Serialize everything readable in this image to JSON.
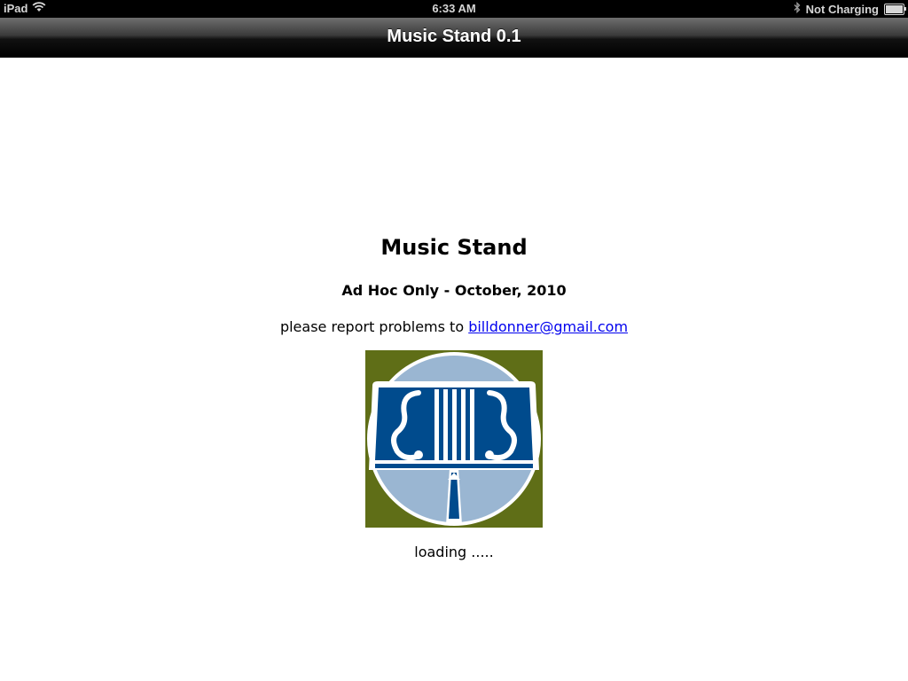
{
  "status_bar": {
    "device": "iPad",
    "time": "6:33 AM",
    "charging": "Not Charging",
    "battery_level": 1.0,
    "icons": [
      "wifi-icon",
      "bluetooth-icon",
      "battery-icon"
    ]
  },
  "nav_bar": {
    "title": "Music Stand 0.1"
  },
  "main": {
    "title": "Music Stand",
    "subtitle": "Ad Hoc Only - October, 2010",
    "report_prefix": "please report problems to ",
    "report_email": "billdonner@gmail.com",
    "logo_icon": "music-stand-logo-icon",
    "loading_text": "loading ....."
  },
  "colors": {
    "logo_background": "#5f6e17",
    "logo_circle": "#9ab6d2",
    "logo_stand": "#004b8d",
    "link": "#0000ee"
  }
}
